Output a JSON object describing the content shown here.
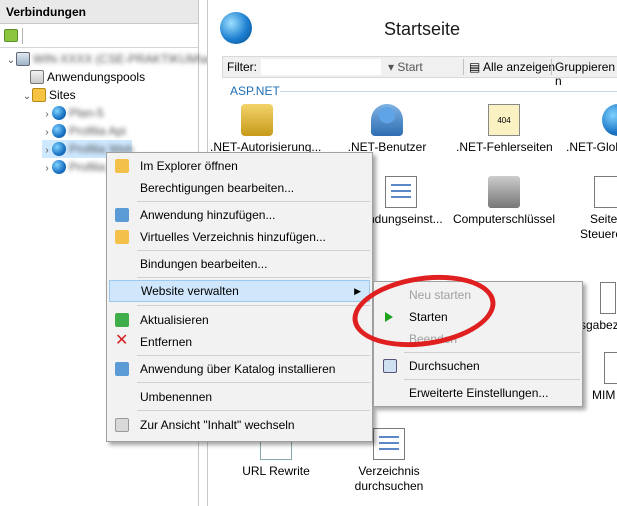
{
  "left": {
    "title": "Verbindungen",
    "tree": {
      "server_label": "WIN-XXXX (CSE-PRAKTIKUM\\admin)",
      "app_pools": "Anwendungspools",
      "sites": "Sites",
      "site_items": [
        "Plan-5",
        "Profilia Api",
        "Profilia Web",
        "Profilia ..."
      ]
    }
  },
  "right": {
    "title": "Startseite",
    "filter": {
      "label": "Filter:",
      "placeholder": "",
      "start": "Start",
      "show_all": "Alle anzeigen",
      "group": "Gruppieren n"
    },
    "section": "ASP.NET",
    "features": [
      ".NET-Autorisierung...",
      ".NET-Benutzer",
      ".NET-Fehlerseiten",
      ".NET-Glob",
      "ndungseinst...",
      "Computerschlüssel",
      "Seite",
      "Steuere",
      "sgabez",
      "MIM",
      "URL Rewrite",
      "Verzeichnis",
      "durchsuchen"
    ],
    "icon_404": "404"
  },
  "context_menu": {
    "items": [
      "Im Explorer öffnen",
      "Berechtigungen bearbeiten...",
      "Anwendung hinzufügen...",
      "Virtuelles Verzeichnis hinzufügen...",
      "Bindungen bearbeiten...",
      "Website verwalten",
      "Aktualisieren",
      "Entfernen",
      "Anwendung über Katalog installieren",
      "Umbenennen",
      "Zur Ansicht \"Inhalt\" wechseln"
    ]
  },
  "submenu": {
    "items": [
      "Neu starten",
      "Starten",
      "Beenden",
      "Durchsuchen",
      "Erweiterte Einstellungen..."
    ]
  }
}
